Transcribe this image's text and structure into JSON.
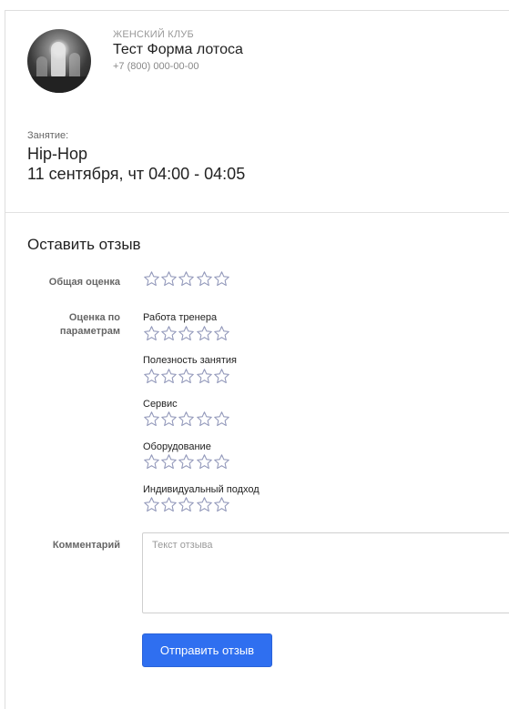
{
  "club": {
    "type": "ЖЕНСКИЙ КЛУБ",
    "name": "Тест Форма лотоса",
    "phone": "+7 (800) 000-00-00"
  },
  "lesson": {
    "label": "Занятие:",
    "name": "Hip-Hop",
    "datetime": "11 сентября, чт 04:00 - 04:05"
  },
  "review": {
    "title": "Оставить отзыв",
    "overall_label": "Общая оценка",
    "overall_rating": 0,
    "params_label": "Оценка по параметрам",
    "params": [
      {
        "label": "Работа тренера",
        "rating": 0
      },
      {
        "label": "Полезность занятия",
        "rating": 0
      },
      {
        "label": "Сервис",
        "rating": 0
      },
      {
        "label": "Оборудование",
        "rating": 0
      },
      {
        "label": "Индивидуальный подход",
        "rating": 0
      }
    ],
    "max_stars": 5,
    "comment_label": "Комментарий",
    "comment_placeholder": "Текст отзыва",
    "comment_value": "",
    "submit_label": "Отправить отзыв"
  },
  "colors": {
    "accent": "#2f6ff0",
    "star_outline": "#8f95b8"
  }
}
